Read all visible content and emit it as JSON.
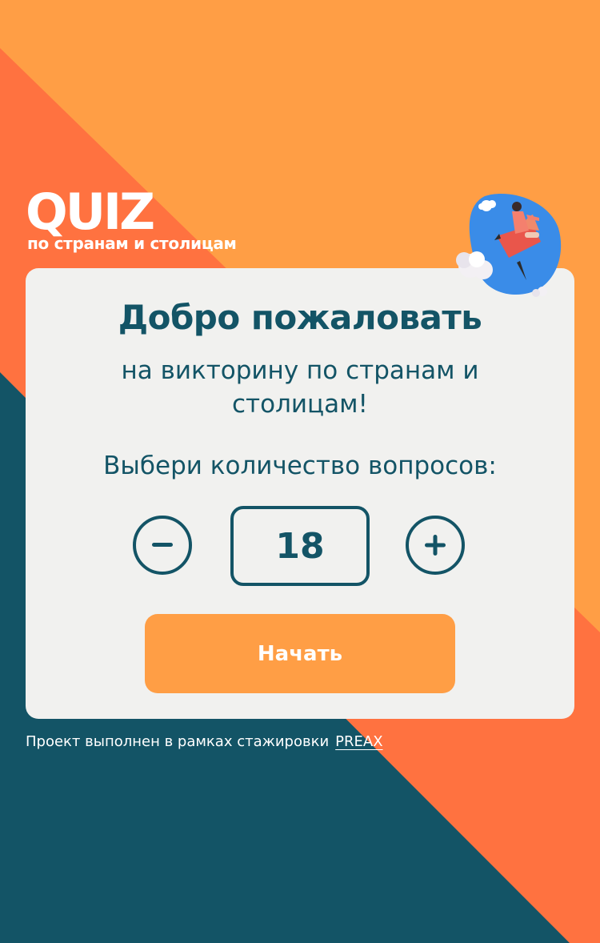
{
  "logo": {
    "title": "QUIZ",
    "subtitle": "по странам и столицам"
  },
  "welcome": {
    "title": "Добро пожаловать",
    "subtitle": "на викторину по странам и столицам!",
    "prompt": "Выбери количество вопросов:"
  },
  "stepper": {
    "value": "18",
    "decrement_icon": "minus-icon",
    "increment_icon": "plus-icon"
  },
  "start_button": {
    "label": "Начать"
  },
  "footer": {
    "text": "Проект выполнен в рамках стажировки",
    "link": "PREAX"
  },
  "colors": {
    "orange_light": "#ff9e45",
    "orange_dark": "#ff7240",
    "teal": "#135466",
    "card": "#f1f1ef",
    "blob_blue": "#3a8ce8"
  }
}
